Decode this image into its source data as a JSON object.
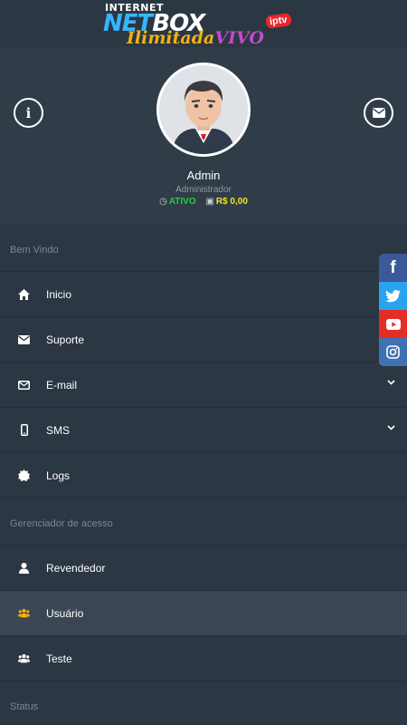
{
  "brand": {
    "line1": "INTERNET",
    "net": "NET",
    "box": "BOX",
    "iptv": "iptv",
    "ilimitada": "Ilimitada",
    "vivo": "VIVO"
  },
  "profile": {
    "name": "Admin",
    "role": "Administrador",
    "status": "ATIVO",
    "balance": "R$ 0,00"
  },
  "menu": {
    "sections": {
      "welcome": "Bem Vindo",
      "access": "Gerenciador de acesso",
      "status": "Status"
    },
    "items": [
      {
        "label": "Inicio",
        "icon": "home-icon"
      },
      {
        "label": "Suporte",
        "icon": "envelope-icon"
      },
      {
        "label": "E-mail",
        "icon": "envelope-outline-icon"
      },
      {
        "label": "SMS",
        "icon": "mobile-icon"
      },
      {
        "label": "Logs",
        "icon": "certificate-icon"
      },
      {
        "label": "Revendedor",
        "icon": "user-icon"
      },
      {
        "label": "Usuário",
        "icon": "users-icon"
      },
      {
        "label": "Teste",
        "icon": "users-icon"
      }
    ]
  },
  "social": [
    "facebook",
    "twitter",
    "youtube",
    "instagram"
  ],
  "colors": {
    "background": "#2c3744",
    "active_item": "#3a4654",
    "status_active": "#22d23b",
    "balance": "#f0e51f",
    "users_icon_active": "#f3b20e"
  }
}
